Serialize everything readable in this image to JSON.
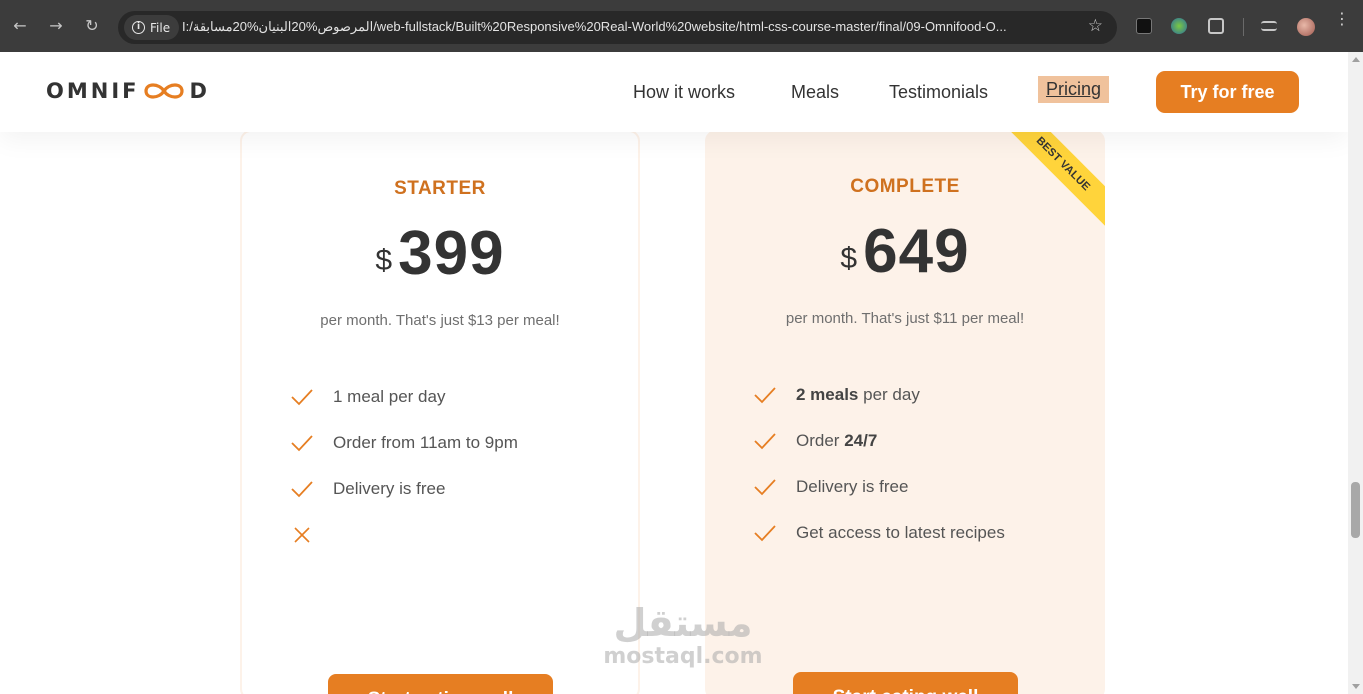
{
  "browser": {
    "site_chip_label": "File",
    "url": "I:/المرصوص%20البنيان%20مسابقة/web-fullstack/Built%20Responsive%20Real-World%20website/html-css-course-master/final/09-Omnifood-O..."
  },
  "header": {
    "logo_text_left": "OMNIF",
    "logo_text_right": "D",
    "nav": [
      "How it works",
      "Meals",
      "Testimonials",
      "Pricing"
    ],
    "active_nav": "Pricing",
    "cta_label": "Try for free"
  },
  "pricing": {
    "starter": {
      "name": "STARTER",
      "currency": "$",
      "price": "399",
      "subtitle": "per month. That's just $13 per meal!",
      "features": [
        {
          "icon": "checkmark-icon",
          "text": "1 meal per day"
        },
        {
          "icon": "checkmark-icon",
          "text": "Order from 11am to 9pm"
        },
        {
          "icon": "checkmark-icon",
          "text": "Delivery is free"
        },
        {
          "icon": "close-icon",
          "text": ""
        }
      ],
      "button_label": "Start eating well"
    },
    "complete": {
      "name": "COMPLETE",
      "currency": "$",
      "price": "649",
      "subtitle": "per month. That's just $11 per meal!",
      "ribbon": "BEST VALUE",
      "features": [
        {
          "icon": "checkmark-icon",
          "bold": "2 meals",
          "text": " per day"
        },
        {
          "icon": "checkmark-icon",
          "text": "Order ",
          "bold_after": "24/7"
        },
        {
          "icon": "checkmark-icon",
          "text": "Delivery is free"
        },
        {
          "icon": "checkmark-icon",
          "text": "Get access to latest recipes"
        }
      ],
      "button_label": "Start eating well"
    }
  },
  "watermark": {
    "arabic": "مستقل",
    "latin": "mostaql.com"
  },
  "colors": {
    "accent": "#e67e22",
    "accent_dark": "#cf711f",
    "tint": "#fdf2e9",
    "ribbon": "#ffd43b"
  }
}
